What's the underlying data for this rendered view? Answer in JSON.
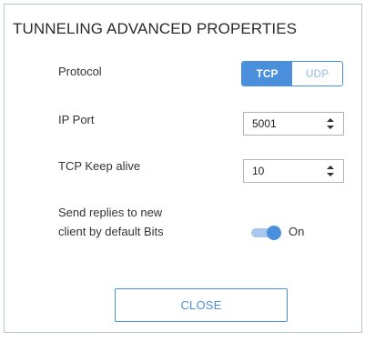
{
  "dialog": {
    "title": "TUNNELING ADVANCED PROPERTIES",
    "accent_color": "#4a8fdc"
  },
  "protocol": {
    "label": "Protocol",
    "options": [
      "TCP",
      "UDP"
    ],
    "selected": "TCP"
  },
  "ip_port": {
    "label": "IP Port",
    "value": "5001"
  },
  "tcp_keep_alive": {
    "label": "TCP Keep alive",
    "value": "10"
  },
  "send_replies": {
    "label_line1": "Send replies to new",
    "label_line2": "client by default Bits",
    "toggle_state": "On"
  },
  "footer": {
    "close_label": "CLOSE"
  }
}
